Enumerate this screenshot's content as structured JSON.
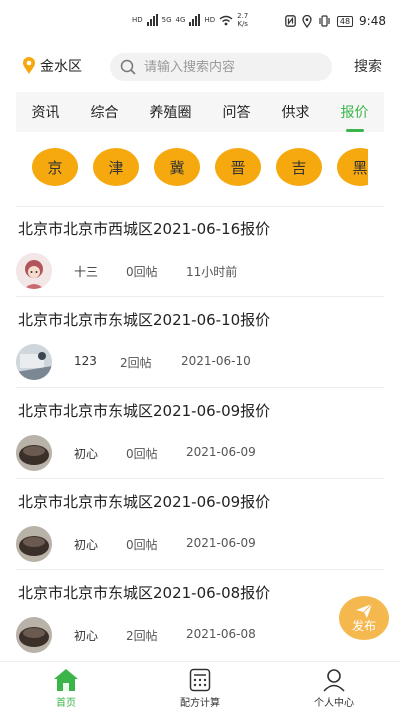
{
  "status_bar": {
    "net_labels": [
      "HD",
      "5G",
      "4G",
      "HD"
    ],
    "speed_value": "2.7",
    "speed_unit": "K/s",
    "battery": "48",
    "time": "9:48"
  },
  "header": {
    "location": "金水区",
    "search_placeholder": "请输入搜索内容",
    "search_button": "搜索"
  },
  "tabs": [
    "资讯",
    "综合",
    "养殖圈",
    "问答",
    "供求",
    "报价"
  ],
  "active_tab": "报价",
  "provinces": [
    "京",
    "津",
    "冀",
    "晋",
    "吉",
    "黑"
  ],
  "posts": [
    {
      "title": "北京市北京市西城区2021-06-16报价",
      "author": "十三",
      "replies": "0回帖",
      "time": "11小时前"
    },
    {
      "title": "北京市北京市东城区2021-06-10报价",
      "author": "123",
      "replies": "2回帖",
      "time": "2021-06-10"
    },
    {
      "title": "北京市北京市东城区2021-06-09报价",
      "author": "初心",
      "replies": "0回帖",
      "time": "2021-06-09"
    },
    {
      "title": "北京市北京市东城区2021-06-09报价",
      "author": "初心",
      "replies": "0回帖",
      "time": "2021-06-09"
    },
    {
      "title": "北京市北京市东城区2021-06-08报价",
      "author": "初心",
      "replies": "2回帖",
      "time": "2021-06-08"
    }
  ],
  "fab": {
    "label": "发布"
  },
  "bottom_nav": [
    {
      "label": "首页",
      "icon": "home-icon"
    },
    {
      "label": "配方计算",
      "icon": "calculator-icon"
    },
    {
      "label": "个人中心",
      "icon": "user-icon"
    }
  ],
  "colors": {
    "accent": "#3bb54a",
    "province": "#f6a80f",
    "fab": "#f4b13c"
  }
}
